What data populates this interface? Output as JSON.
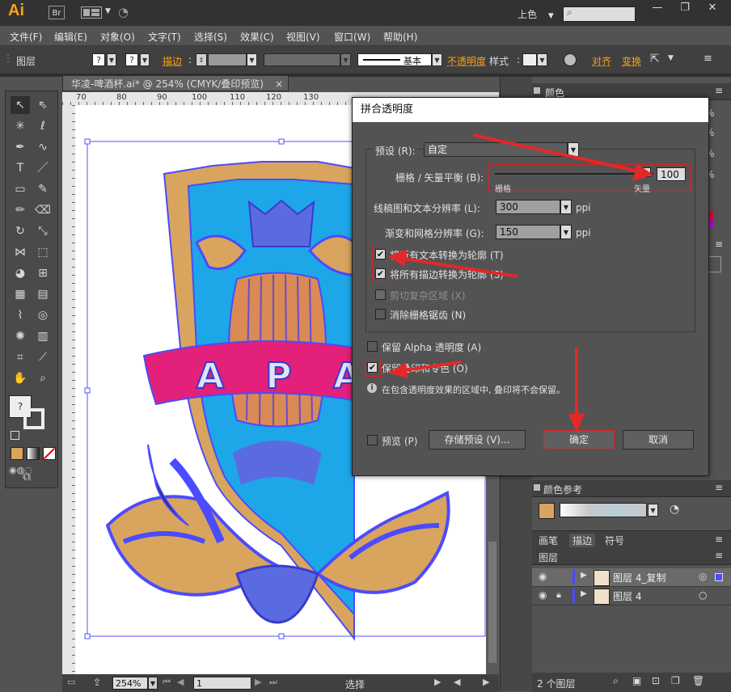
{
  "app": {
    "logo": "Ai",
    "bridge": "Br",
    "workspace": "上色",
    "search_placeholder": ""
  },
  "menubar": [
    "文件(F)",
    "编辑(E)",
    "对象(O)",
    "文字(T)",
    "选择(S)",
    "效果(C)",
    "视图(V)",
    "窗口(W)",
    "帮助(H)"
  ],
  "controlbar": {
    "layer_label": "图层",
    "stroke_label": "描边",
    "stroke_style": "基本",
    "opacity_label": "不透明度",
    "style_label": "样式",
    "align_label": "对齐",
    "transform_label": "变换",
    "fill_swatch": "?",
    "stroke_swatch": "?"
  },
  "document": {
    "tab_title": "华凌-啤酒杯.ai* @ 254% (CMYK/叠印预览)",
    "close": "×",
    "ruler_top": [
      "70",
      "80",
      "90",
      "100",
      "110",
      "120",
      "130",
      "140",
      "150",
      "160",
      "170"
    ],
    "ruler_left": [
      "1",
      "1",
      "2",
      "1",
      "3",
      "1",
      "4",
      "1",
      "5",
      "1",
      "6",
      "1",
      "7",
      "1",
      "8",
      "1",
      "9"
    ],
    "zoom": "254%",
    "artboard_num": "1",
    "status_text": "选择",
    "logo_letters": "A P A A"
  },
  "dialog": {
    "title": "拼合透明度",
    "preset_label": "预设 (R):",
    "preset_value": "自定",
    "balance_label": "栅格 / 矢量平衡 (B):",
    "balance_value": "100",
    "balance_min_label": "栅格",
    "balance_max_label": "矢量",
    "lineart_label": "线稿图和文本分辨率 (L):",
    "lineart_value": "300",
    "gradient_label": "渐变和网格分辨率 (G):",
    "gradient_value": "150",
    "unit_ppi": "ppi",
    "cb_text_outline": "将所有文本转换为轮廓 (T)",
    "cb_stroke_outline": "将所有描边转换为轮廓 (S)",
    "cb_clip_complex": "剪切复杂区域 (X)",
    "cb_antialias": "消除栅格锯齿 (N)",
    "cb_preserve_alpha": "保留 Alpha 透明度 (A)",
    "cb_preserve_overprint": "保留叠印和专色 (O)",
    "info_text": "在包含透明度效果的区域中, 叠印将不会保留。",
    "cb_preview": "预览 (P)",
    "btn_save_preset": "存储预设 (V)...",
    "btn_ok": "确定",
    "btn_cancel": "取消",
    "checks": {
      "text_outline": true,
      "stroke_outline": true,
      "clip_complex": false,
      "antialias": false,
      "preserve_alpha": false,
      "preserve_overprint": true,
      "preview": false
    }
  },
  "panels": {
    "color_tab": "颜色",
    "color_guide_tab": "颜色参考",
    "brush_tab": "画笔",
    "stroke_tab": "描边",
    "symbol_tab": "符号",
    "layers_tab": "图层",
    "layers": [
      {
        "name": "图层 4_复制",
        "color": "#4b4bff"
      },
      {
        "name": "图层 4",
        "color": "#4b4bff"
      }
    ],
    "layer_count": "2 个图层",
    "pct_labels": [
      "%",
      "%",
      "%",
      "%"
    ]
  },
  "colors": {
    "accent_orange": "#f7a21b",
    "annotation_red": "#e42828",
    "selection_blue": "#5050ff",
    "shield_cyan": "#1ea7e8",
    "shield_tan": "#d9a45e",
    "ribbon_pink": "#e3207a"
  }
}
